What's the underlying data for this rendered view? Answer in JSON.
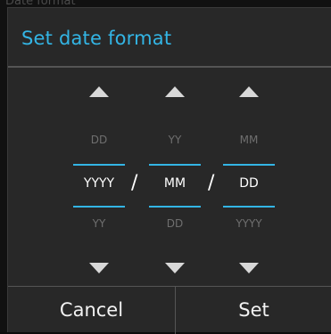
{
  "background_title": "Date format",
  "dialog": {
    "title": "Set date format",
    "pickers": [
      {
        "above": "DD",
        "selected": "YYYY",
        "below": "YY"
      },
      {
        "above": "YY",
        "selected": "MM",
        "below": "DD"
      },
      {
        "above": "MM",
        "selected": "DD",
        "below": "YYYY"
      }
    ],
    "separator": "/",
    "buttons": {
      "cancel": "Cancel",
      "set": "Set"
    }
  },
  "colors": {
    "accent": "#33b5e5",
    "dialog_bg": "#282828"
  }
}
